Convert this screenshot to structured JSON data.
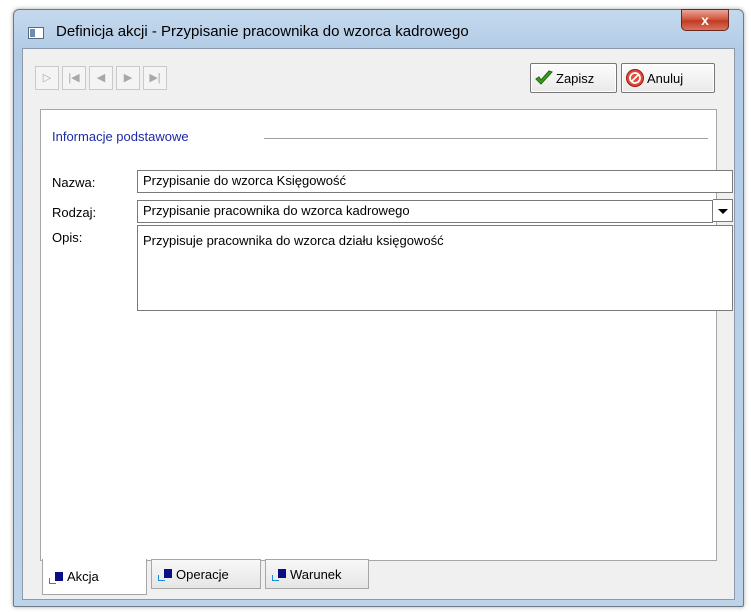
{
  "window": {
    "title": "Definicja akcji - Przypisanie pracownika do wzorca kadrowego",
    "close_label": "x"
  },
  "toolbar": {
    "nav_icons": [
      "new-record-icon",
      "first-record-icon",
      "previous-record-icon",
      "next-record-icon",
      "last-record-icon"
    ],
    "save_label": "Zapisz",
    "cancel_label": "Anuluj"
  },
  "form": {
    "section_title": "Informacje podstawowe",
    "name_label": "Nazwa:",
    "name_value": "Przypisanie do wzorca Księgowość",
    "type_label": "Rodzaj:",
    "type_value": "Przypisanie pracownika do wzorca kadrowego",
    "description_label": "Opis:",
    "description_value": "Przypisuje pracownika do wzorca działu księgowość"
  },
  "tabs": [
    {
      "label": "Akcja",
      "active": true
    },
    {
      "label": "Operacje",
      "active": false
    },
    {
      "label": "Warunek",
      "active": false
    }
  ],
  "colors": {
    "section_title": "#1c2aa6",
    "close_button": "#c13c24",
    "tab_icon": "#0a0f85"
  }
}
